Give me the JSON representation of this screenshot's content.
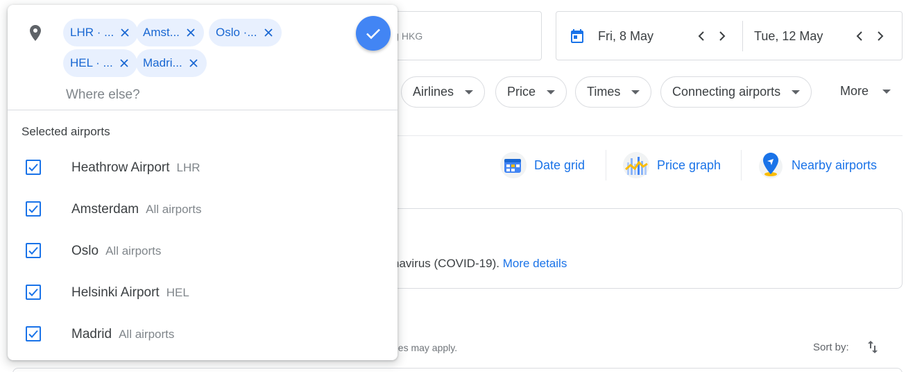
{
  "search": {
    "destination_partial": "g",
    "destination_code": "HKG"
  },
  "dates": {
    "depart": "Fri, 8 May",
    "return": "Tue, 12 May"
  },
  "filters": {
    "chips": [
      "Airlines",
      "Price",
      "Times",
      "Connecting airports"
    ],
    "more_label": "More"
  },
  "tools": {
    "date_grid": "Date grid",
    "price_graph": "Price graph",
    "nearby_airports": "Nearby airports"
  },
  "notice": {
    "text": "navirus (COVID-19).",
    "link": "More details"
  },
  "results": {
    "fees_text": "ees may apply.",
    "sort_label": "Sort by:"
  },
  "popup": {
    "tags": [
      "LHR · ...",
      "Amst...",
      "Oslo ·...",
      "HEL · ...",
      "Madri..."
    ],
    "input_placeholder": "Where else?",
    "section_title": "Selected airports",
    "airports": [
      {
        "name": "Heathrow Airport",
        "sub": "LHR",
        "checked": true
      },
      {
        "name": "Amsterdam",
        "sub": "All airports",
        "checked": true
      },
      {
        "name": "Oslo",
        "sub": "All airports",
        "checked": true
      },
      {
        "name": "Helsinki Airport",
        "sub": "HEL",
        "checked": true
      },
      {
        "name": "Madrid",
        "sub": "All airports",
        "checked": true
      }
    ]
  },
  "colors": {
    "accent": "#1a73e8",
    "tag_bg": "#e8f0fe",
    "done_button": "#4285f4"
  },
  "icons": [
    "location-pin-icon",
    "close-icon",
    "check-icon",
    "calendar-icon",
    "chevron-left-icon",
    "chevron-right-icon",
    "caret-down-icon",
    "date-grid-icon",
    "price-graph-icon",
    "nearby-airports-icon",
    "sort-icon",
    "checkbox-checked-icon"
  ]
}
